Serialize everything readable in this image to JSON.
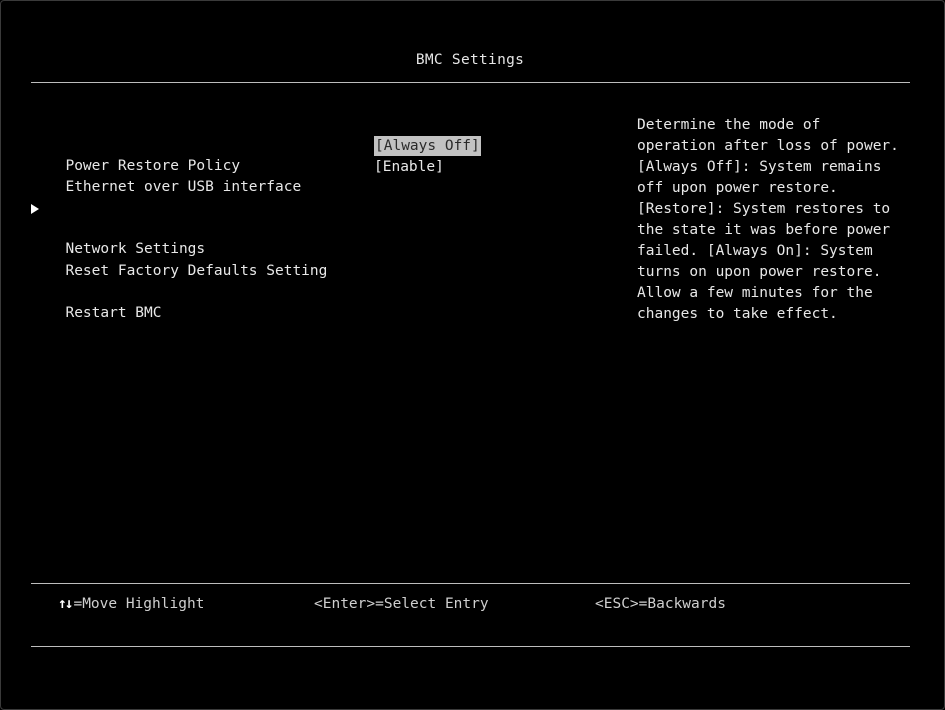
{
  "header": {
    "title": "BMC Settings"
  },
  "menu": {
    "items": [
      {
        "label": "Power Restore Policy",
        "value": "[Always Off]"
      },
      {
        "label": "Ethernet over USB interface",
        "value": "[Enable]"
      },
      {
        "label": "Network Settings"
      },
      {
        "label": "Reset Factory Defaults Setting"
      },
      {
        "label": "Restart BMC"
      }
    ]
  },
  "help": {
    "lines": [
      "Determine the mode of",
      "operation after loss of power.",
      "[Always Off]: System remains",
      "off upon power restore.",
      "[Restore]: System restores to",
      "the state it was before power",
      "failed. [Always On]: System",
      "turns on upon power restore.",
      "Allow a few minutes for the",
      "changes to take effect."
    ]
  },
  "footer": {
    "arrows_glyph": "↑↓",
    "move_hint": "=Move Highlight",
    "enter_hint": "<Enter>=Select Entry",
    "esc_hint": "<ESC>=Backwards"
  },
  "colors": {
    "background": "#000000",
    "text": "#e8e8e8",
    "selected_bg": "#c2c2c2",
    "selected_fg": "#2a2a2a",
    "rule": "#bdbdbd"
  }
}
